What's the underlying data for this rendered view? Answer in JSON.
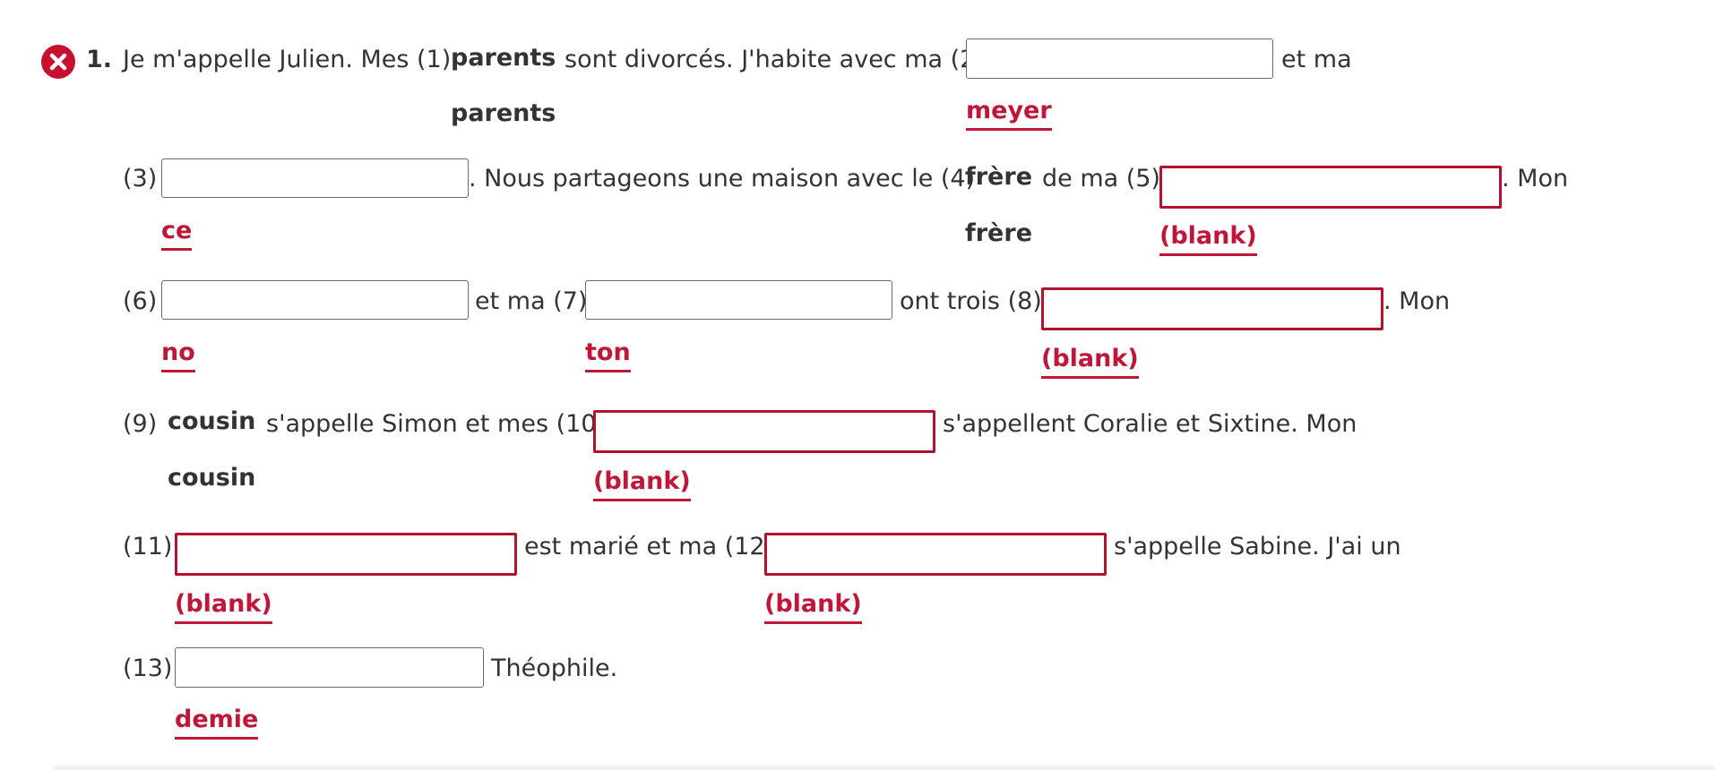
{
  "question": {
    "number": "1.",
    "status_icon": "error-x-icon",
    "colors": {
      "error": "#c8102e",
      "answer_text": "#c0163a",
      "body_text": "#333333",
      "input_border": "#6b6b6b"
    },
    "text": {
      "l1_a": "Je m'appelle Julien. Mes (1)",
      "l1_b": "sont divorcés. J'habite avec ma (2)",
      "l1_c": "et ma",
      "l2_a": "(3)",
      "l2_b": ". Nous partageons une maison avec le (4)",
      "l2_c": "de ma (5)",
      "l2_d": ". Mon",
      "l3_a": "(6)",
      "l3_b": "et ma (7)",
      "l3_c": "ont trois (8)",
      "l3_d": ". Mon",
      "l4_a": "(9)",
      "l4_b": "s'appelle Simon et mes (10)",
      "l4_c": "s'appellent Coralie et Sixtine. Mon",
      "l5_a": "(11)",
      "l5_b": "est marié et ma (12)",
      "l5_c": "s'appelle Sabine. J'ai un",
      "l6_a": "(13)",
      "l6_b": "Théophile."
    },
    "given_words": {
      "b1": "parents",
      "b4": "frère",
      "b9": "cousin"
    },
    "blanks": {
      "b1": {
        "response": "parents"
      },
      "b2": {
        "value": "",
        "response": "meyer"
      },
      "b3": {
        "value": "",
        "response": "ce"
      },
      "b4": {
        "response": "frère"
      },
      "b5": {
        "value": "",
        "response": "(blank)"
      },
      "b6": {
        "value": "",
        "response": "no"
      },
      "b7": {
        "value": "",
        "response": "ton"
      },
      "b8": {
        "value": "",
        "response": "(blank)"
      },
      "b9": {
        "response": "cousin"
      },
      "b10": {
        "value": "",
        "response": "(blank)"
      },
      "b11": {
        "value": "",
        "response": "(blank)"
      },
      "b12": {
        "value": "",
        "response": "(blank)"
      },
      "b13": {
        "value": "",
        "response": "demie"
      }
    }
  }
}
